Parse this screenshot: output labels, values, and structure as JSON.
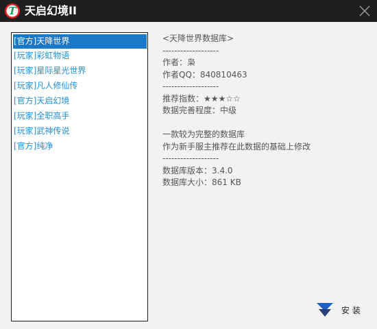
{
  "window": {
    "title": "天启幻境II",
    "logo_letter": "T",
    "close_icon": "close-icon"
  },
  "db_list": {
    "selected_index": 0,
    "items": [
      {
        "label": "[官方]天降世界"
      },
      {
        "label": "[玩家]彩虹物语"
      },
      {
        "label": "[玩家]星际星光世界"
      },
      {
        "label": "[玩家]凡人修仙传"
      },
      {
        "label": "[官方]天启幻境"
      },
      {
        "label": "[玩家]全职高手"
      },
      {
        "label": "[玩家]武神传说"
      },
      {
        "label": "[官方]纯净"
      }
    ]
  },
  "info": {
    "lines": [
      "<天降世界数据库>",
      "-------------------",
      "作者：枭",
      "作者QQ：840810463",
      "-------------------",
      "推荐指数：★★★☆☆",
      "数据完善程度：中级",
      "",
      "一款较为完整的数据库",
      "作为新手服主推荐在此数据的基础上修改",
      "-------------------",
      "数据库版本：3.4.0",
      "数据库大小：861 KB"
    ]
  },
  "install": {
    "label": "安装",
    "icon": "download-arrow-icon"
  },
  "colors": {
    "titlebar": "#1f1f1f",
    "selection": "#1a78c8",
    "list_text": "#1e8fd6",
    "logo_ring": "#e02020",
    "logo_letter": "#18a058",
    "install_icon": "#1e5fc8"
  }
}
